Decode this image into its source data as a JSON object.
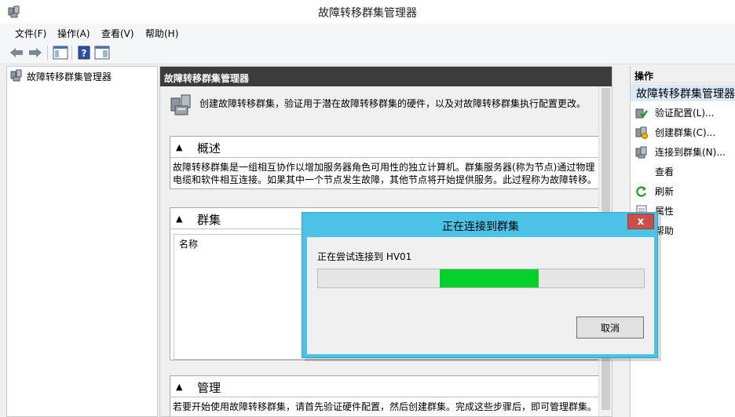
{
  "window": {
    "title": "故障转移群集管理器",
    "app_icon": "cluster-manager-icon"
  },
  "menubar": {
    "items": [
      "文件(F)",
      "操作(A)",
      "查看(V)",
      "帮助(H)"
    ]
  },
  "toolbar": {
    "buttons": [
      "back-arrow-icon",
      "forward-arrow-icon",
      "show-hide-console-tree-icon",
      "help-icon",
      "show-hide-action-pane-icon"
    ]
  },
  "tree": {
    "root_label": "故障转移群集管理器"
  },
  "center": {
    "header": "故障转移群集管理器",
    "intro": "创建故障转移群集，验证用于潜在故障转移群集的硬件，以及对故障转移群集执行配置更改。",
    "overview": {
      "title": "概述",
      "body": "故障转移群集是一组相互协作以增加服务器角色可用性的独立计算机。群集服务器(称为节点)通过物理电缆和软件相互连接。如果其中一个节点发生故障，其他节点将开始提供服务。此过程称为故障转移。"
    },
    "clusters": {
      "title": "群集",
      "column_name": "名称"
    },
    "manage": {
      "title": "管理",
      "body": "若要开始使用故障转移群集，请首先验证硬件配置，然后创建群集。完成这些步骤后，即可管理群集。"
    }
  },
  "actions": {
    "header": "操作",
    "group": "故障转移群集管理器",
    "items": [
      {
        "label": "验证配置(L)...",
        "icon": "validate-configuration-icon"
      },
      {
        "label": "创建群集(C)...",
        "icon": "create-cluster-icon"
      },
      {
        "label": "连接到群集(N)...",
        "icon": "connect-cluster-icon"
      },
      {
        "label": "查看",
        "icon": ""
      },
      {
        "label": "刷新",
        "icon": "refresh-icon"
      },
      {
        "label": "属性",
        "icon": "properties-icon"
      },
      {
        "label": "帮助",
        "icon": "help-icon"
      }
    ]
  },
  "dialog": {
    "title": "正在连接到群集",
    "status": "正在尝试连接到 HV01",
    "progress": {
      "start_fraction": 0.373,
      "end_fraction": 0.678
    },
    "cancel_label": "取消",
    "close_glyph": "x"
  },
  "colors": {
    "dialog_frame": "#4cc3e6",
    "progress_fill": "#06d12b",
    "close_button": "#c9504a",
    "center_header": "#3c3c3c",
    "action_group_bg": "#dce9f7"
  }
}
